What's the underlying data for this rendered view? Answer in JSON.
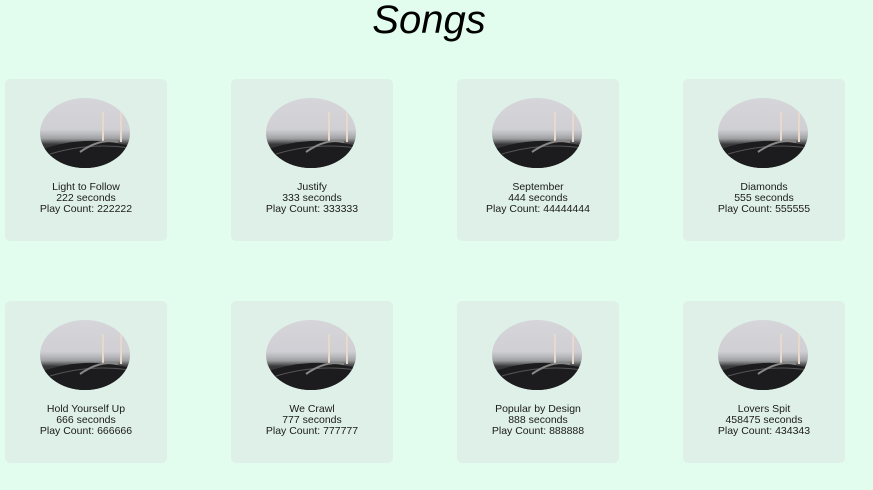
{
  "page": {
    "title": "Songs"
  },
  "songs": [
    {
      "name": "Light to Follow",
      "duration": "222 seconds",
      "plays": "Play Count: 222222"
    },
    {
      "name": "Justify",
      "duration": "333 seconds",
      "plays": "Play Count: 333333"
    },
    {
      "name": "September",
      "duration": "444 seconds",
      "plays": "Play Count: 44444444"
    },
    {
      "name": "Diamonds",
      "duration": "555 seconds",
      "plays": "Play Count: 555555"
    },
    {
      "name": "Hold Yourself Up",
      "duration": "666 seconds",
      "plays": "Play Count: 666666"
    },
    {
      "name": "We Crawl",
      "duration": "777 seconds",
      "plays": "Play Count: 777777"
    },
    {
      "name": "Popular by Design",
      "duration": "888 seconds",
      "plays": "Play Count: 888888"
    },
    {
      "name": "Lovers Spit",
      "duration": "458475 seconds",
      "plays": "Play Count: 434343"
    }
  ],
  "colors": {
    "background": "#e2fdee",
    "card": "#dff0e8"
  },
  "icons": {
    "cover": "vinyl-record-image"
  }
}
